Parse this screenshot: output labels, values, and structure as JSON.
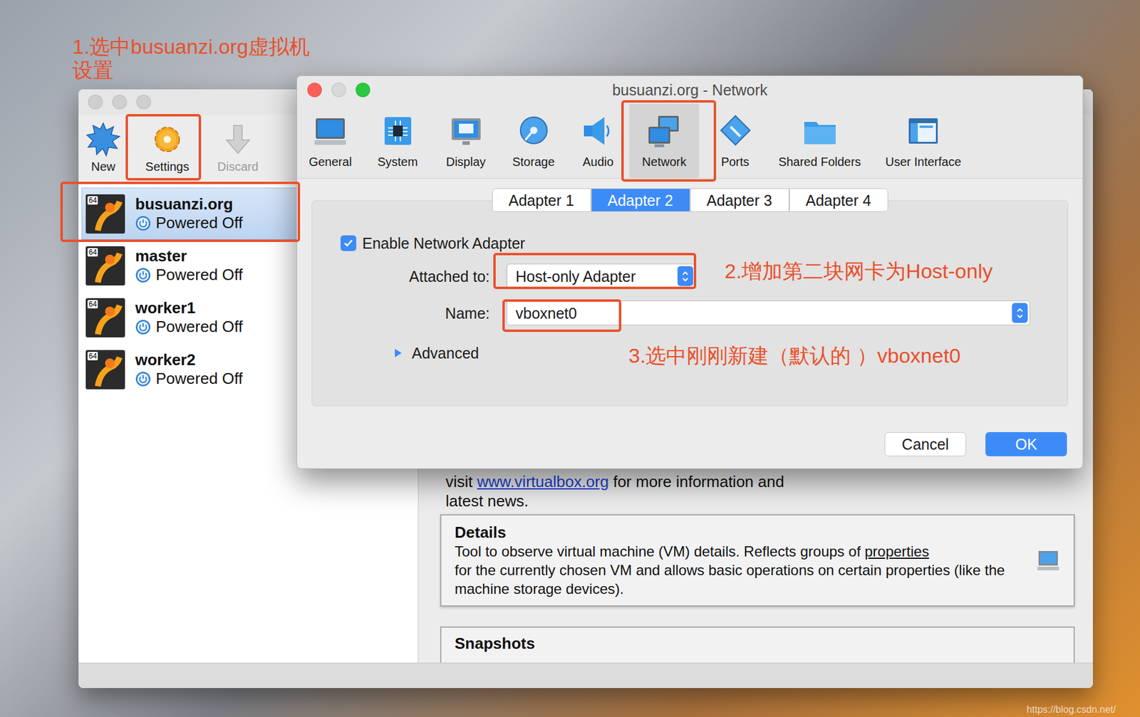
{
  "desktop": {
    "watermark": "https://blog.csdn.net/"
  },
  "annotations": {
    "step1": [
      "1.选中busuanzi.org虚拟机",
      "设置"
    ],
    "step2": "2.增加第二块网卡为Host-only",
    "step3": "3.选中刚刚新建（默认的 ）vboxnet0"
  },
  "manager": {
    "toolbar": [
      {
        "label": "New",
        "kind": "new",
        "disabled": false
      },
      {
        "label": "Settings",
        "kind": "settings",
        "disabled": false
      },
      {
        "label": "Discard",
        "kind": "discard",
        "disabled": true
      }
    ],
    "vms": [
      {
        "name": "busuanzi.org",
        "state": "Powered Off",
        "badge": "64",
        "selected": true
      },
      {
        "name": "master",
        "state": "Powered Off",
        "badge": "64",
        "selected": false
      },
      {
        "name": "worker1",
        "state": "Powered Off",
        "badge": "64",
        "selected": false
      },
      {
        "name": "worker2",
        "state": "Powered Off",
        "badge": "64",
        "selected": false
      }
    ],
    "welcome": {
      "prefix": "visit ",
      "link": "www.virtualbox.org",
      "suffix": " for more information and",
      "line2": "latest news."
    },
    "details": {
      "title": "Details",
      "before": "Tool to observe virtual machine (VM) details. Reflects groups of ",
      "link": "properties",
      "after": "for the currently chosen VM and allows basic operations on certain properties (like the machine storage devices)."
    },
    "snapshots": {
      "title": "Snapshots"
    }
  },
  "dialog": {
    "title": "busuanzi.org - Network",
    "categories": [
      {
        "label": "General",
        "kind": "general",
        "selected": false
      },
      {
        "label": "System",
        "kind": "system",
        "selected": false
      },
      {
        "label": "Display",
        "kind": "display",
        "selected": false
      },
      {
        "label": "Storage",
        "kind": "storage",
        "selected": false
      },
      {
        "label": "Audio",
        "kind": "audio",
        "selected": false
      },
      {
        "label": "Network",
        "kind": "network",
        "selected": true
      },
      {
        "label": "Ports",
        "kind": "ports",
        "selected": false
      },
      {
        "label": "Shared Folders",
        "kind": "shared",
        "selected": false
      },
      {
        "label": "User Interface",
        "kind": "ui",
        "selected": false
      }
    ],
    "tabs": [
      {
        "label": "Adapter 1",
        "selected": false
      },
      {
        "label": "Adapter 2",
        "selected": true
      },
      {
        "label": "Adapter 3",
        "selected": false
      },
      {
        "label": "Adapter 4",
        "selected": false
      }
    ],
    "enable": {
      "label": "Enable Network Adapter",
      "checked": true
    },
    "attached": {
      "label": "Attached to:",
      "value": "Host-only Adapter"
    },
    "name": {
      "label": "Name:",
      "value": "vboxnet0"
    },
    "advanced": {
      "label": "Advanced",
      "expanded": false
    },
    "buttons": [
      {
        "label": "Cancel",
        "default": false
      },
      {
        "label": "OK",
        "default": true
      }
    ]
  }
}
